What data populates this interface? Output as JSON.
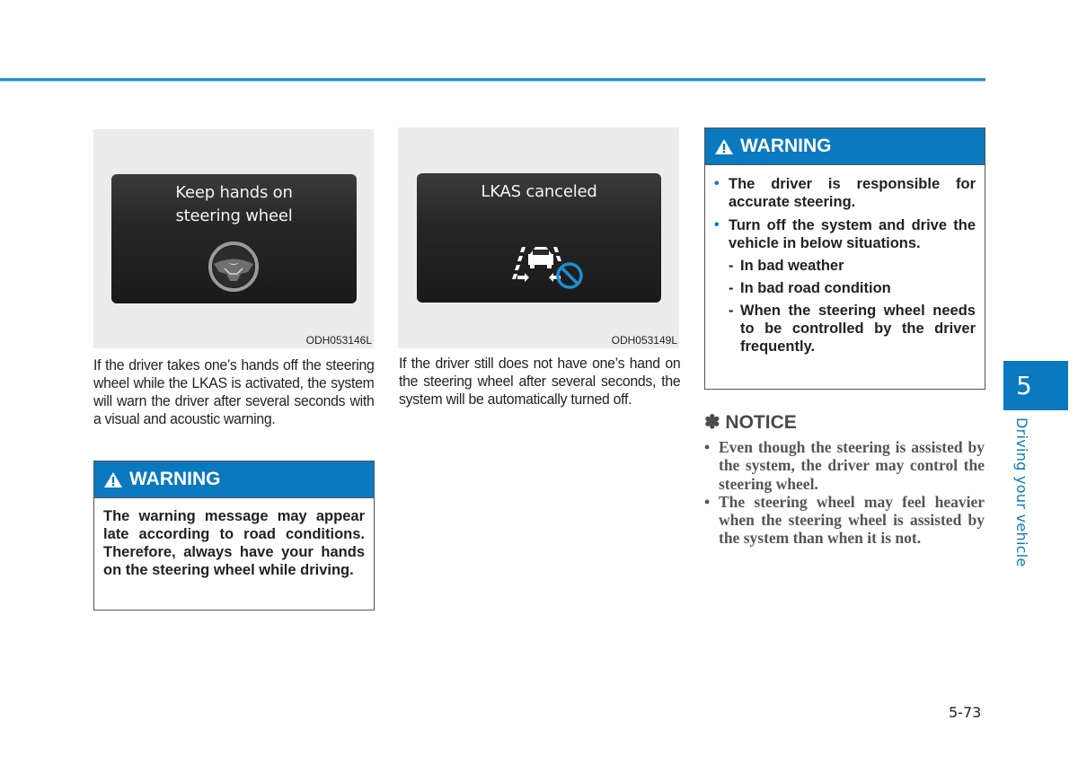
{
  "page": {
    "page_number": "5-73",
    "chapter_number": "5",
    "chapter_title": "Driving your vehicle",
    "accent_color": "#0a79bf"
  },
  "figures": [
    {
      "screen_message_line1": "Keep hands on",
      "screen_message_line2": "steering wheel",
      "icon": "steering-wheel-icon",
      "code": "ODH053146L"
    },
    {
      "screen_message_line1": "LKAS canceled",
      "icon": "lane-keeping-canceled-icon",
      "code": "ODH053149L"
    }
  ],
  "col1": {
    "paragraph": "If the driver takes one’s hands off the steering wheel while the LKAS is activated, the system will warn the driver after several seconds with a visual and acoustic warning.",
    "warning": {
      "title": "WARNING",
      "text": "The warning message may appear late according to road conditions. Therefore, always have your hands on the steering wheel while driving."
    }
  },
  "col2": {
    "paragraph": "If the driver still does not have one’s hand on the steering wheel after several seconds, the system will be automatically turned off."
  },
  "col3": {
    "warning": {
      "title": "WARNING",
      "bullets": [
        "The driver is responsible for accurate steering.",
        "Turn off the system and drive the vehicle in below situations."
      ],
      "sub_items": [
        "In bad weather",
        "In bad road condition",
        "When the steering wheel needs to be controlled by the driver frequently."
      ]
    },
    "notice": {
      "title": "✽ NOTICE",
      "items": [
        "Even though the steering is assisted by the system, the driver may control the steering wheel.",
        "The steering wheel may feel heavier when the steering wheel is assisted by the system than when it is not."
      ]
    }
  }
}
